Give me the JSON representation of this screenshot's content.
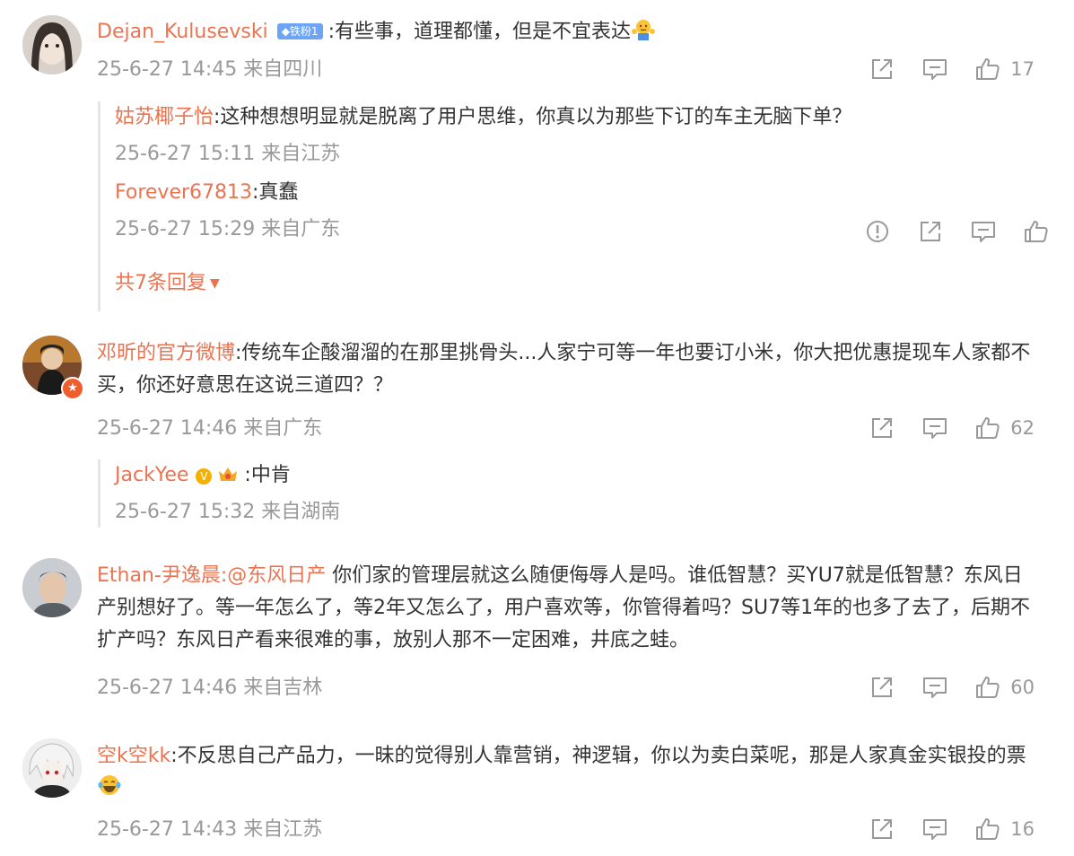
{
  "comments": [
    {
      "user": "Dejan_Kulusevski",
      "fans_badge": "◆铁粉1",
      "text": ":有些事，道理都懂，但是不宜表达",
      "time": "25-6-27 14:45 来自四川",
      "likes": "17",
      "replies": [
        {
          "user": "姑苏椰子怡",
          "text": ":这种想想明显就是脱离了用户思维，你真以为那些下订的车主无脑下单？",
          "time": "25-6-27 15:11 来自江苏"
        },
        {
          "user": "Forever67813",
          "text": ":真蠢",
          "time": "25-6-27 15:29 来自广东"
        }
      ],
      "more_replies": "共7条回复"
    },
    {
      "user": "邓昕的官方微博",
      "text": ":传统车企酸溜溜的在那里挑骨头...人家宁可等一年也要订小米，你大把优惠提现车人家都不买，你还好意思在这说三道四？？",
      "time": "25-6-27 14:46 来自广东",
      "likes": "62",
      "replies": [
        {
          "user": "JackYee",
          "text": ":中肯",
          "time": "25-6-27 15:32 来自湖南"
        }
      ]
    },
    {
      "user": "Ethan-尹逸晨",
      "mention": ":@东风日产",
      "text": " 你们家的管理层就这么随便侮辱人是吗。谁低智慧？买YU7就是低智慧？东风日产别想好了。等一年怎么了，等2年又怎么了，用户喜欢等，你管得着吗？SU7等1年的也多了去了，后期不扩产吗？东风日产看来很难的事，放别人那不一定困难，井底之蛙。",
      "time": "25-6-27 14:46 来自吉林",
      "likes": "60"
    },
    {
      "user": "空k空kk",
      "text": ":不反思自己产品力，一昧的觉得别人靠营销，神逻辑，你以为卖白菜呢，那是人家真金实银投的票",
      "time": "25-6-27 14:43 来自江苏",
      "likes": "16"
    }
  ],
  "icons": {
    "share": "share-icon",
    "comment": "comment-icon",
    "like": "like-icon",
    "report": "report-icon"
  },
  "colors": {
    "name": "#eb7350",
    "meta": "#999999",
    "text": "#333333",
    "verify": "#f05d2c"
  }
}
